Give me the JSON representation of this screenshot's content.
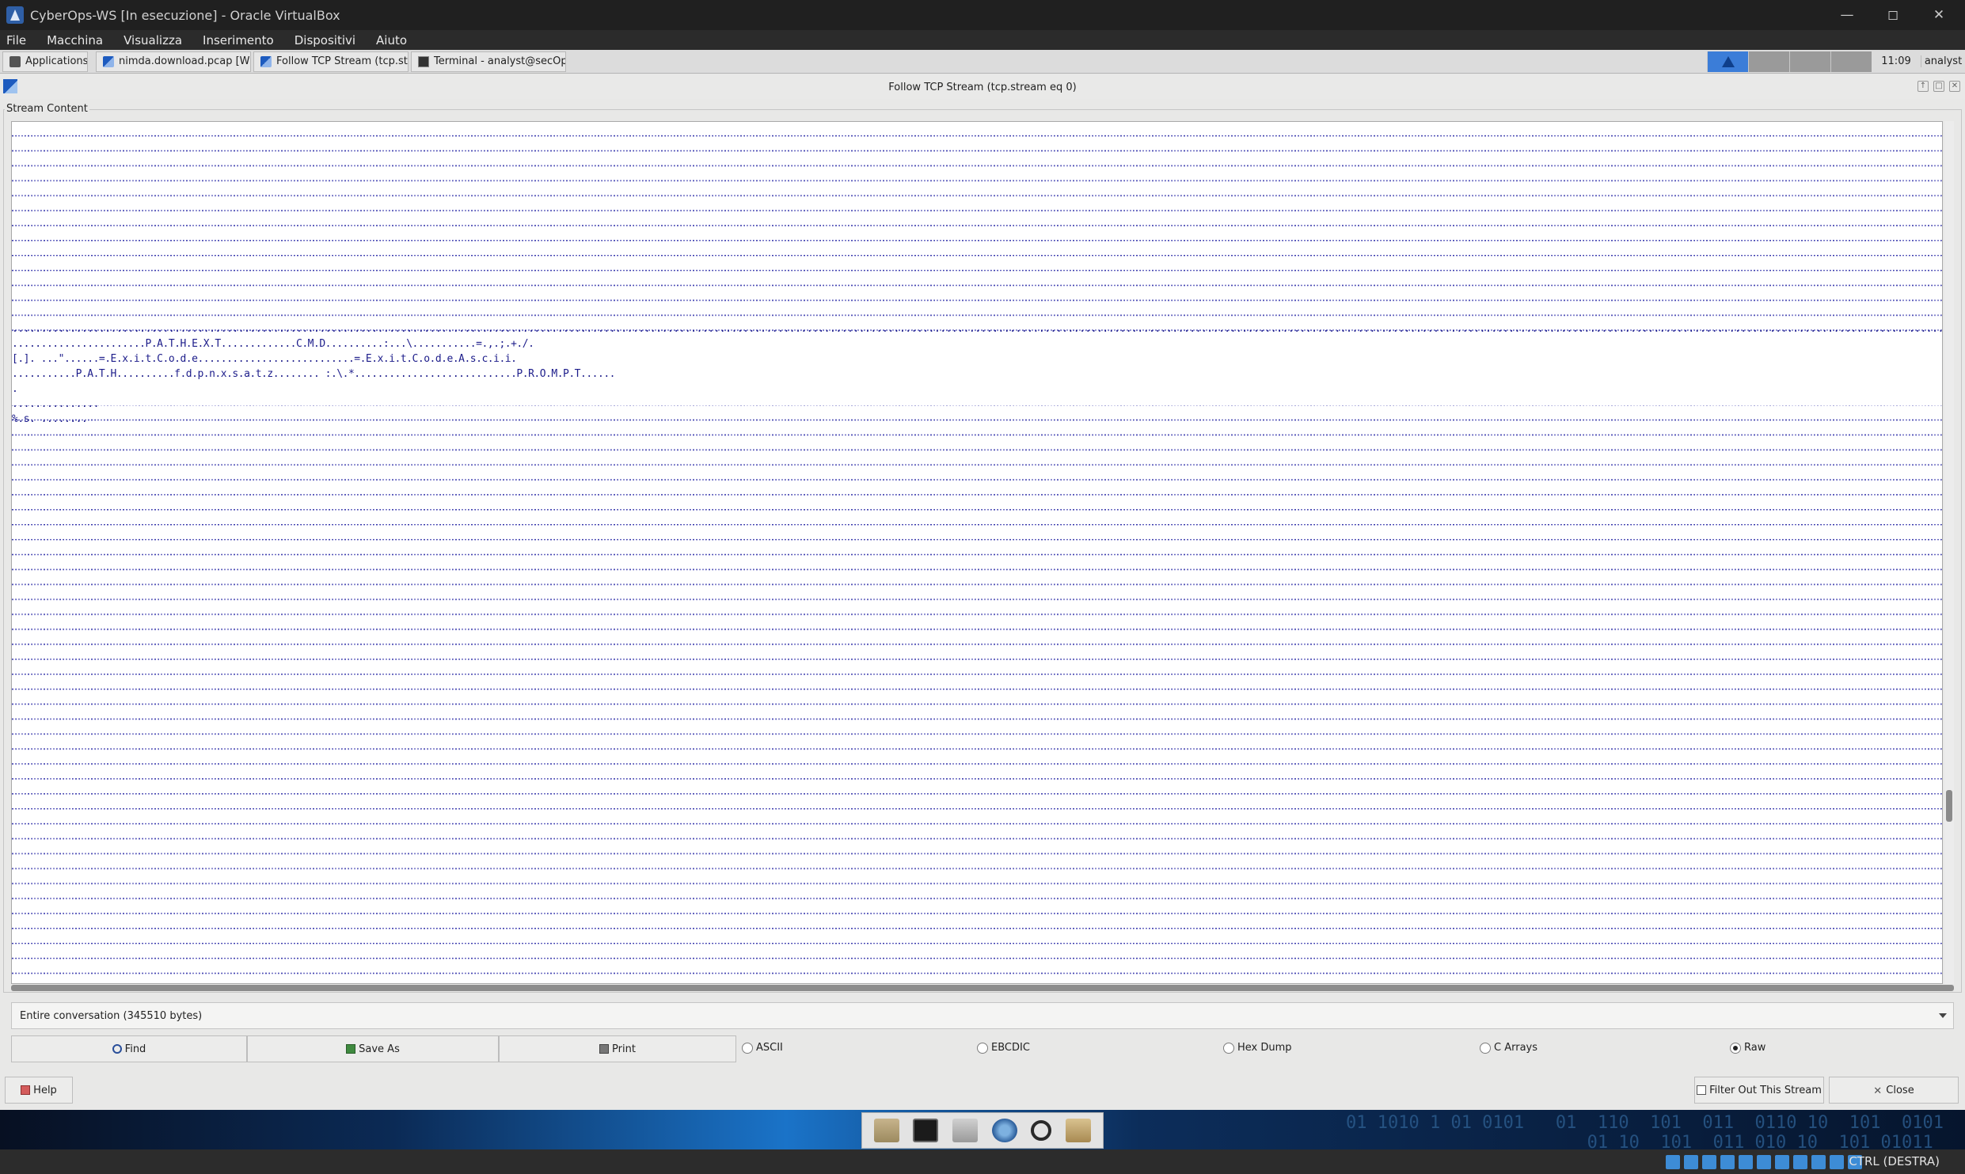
{
  "host": {
    "title": "CyberOps-WS [In esecuzione] - Oracle VirtualBox",
    "menu": [
      "File",
      "Macchina",
      "Visualizza",
      "Inserimento",
      "Dispositivi",
      "Aiuto"
    ],
    "status_hostkey": "CTRL (DESTRA)"
  },
  "panel": {
    "applications": "Applications",
    "tasks": [
      "nimda.download.pcap [Wire...",
      "Follow TCP Stream (tcp.stre...",
      "Terminal - analyst@secOps:..."
    ],
    "clock": "11:09",
    "user": "analyst"
  },
  "dialog": {
    "title": "Follow TCP Stream (tcp.stream eq 0)",
    "frame_label": "Stream Content",
    "stream_lines": [
      "................................................................................................................................................................................................................................................................................................................................................................................................................................................................................................................................................F.O.R./.?.......I.F./.?.........R.E.M./.?.....................................................................................................................................................................................................................=.,.;.",
      ".......................P.A.T.H.E.X.T.............C.M.D..........:...\\...........=.,.;.+./.",
      "[.]. ...\"......=.E.x.i.t.C.o.d.e...........................=.E.x.i.t.C.o.d.e.A.s.c.i.i.",
      "...........P.A.T.H..........f.d.p.n.x.s.a.t.z........ :.\\.*............................P.R.O.M.P.T......",
      ".",
      "...............",
      "%.s. ........"
    ],
    "conversation": "Entire conversation (345510 bytes)",
    "buttons": {
      "find": "Find",
      "save_as": "Save As",
      "print": "Print",
      "help": "Help",
      "filter_out": "Filter Out This Stream",
      "close": "Close"
    },
    "formats": [
      "ASCII",
      "EBCDIC",
      "Hex Dump",
      "C Arrays",
      "Raw"
    ],
    "selected_format": "Raw"
  },
  "desktop": {
    "binary_text": "01 1010 1 01 0101   01  110  101  011  0110 10  101  0101\n                       01 10  101  011 010 10  101 01011"
  }
}
